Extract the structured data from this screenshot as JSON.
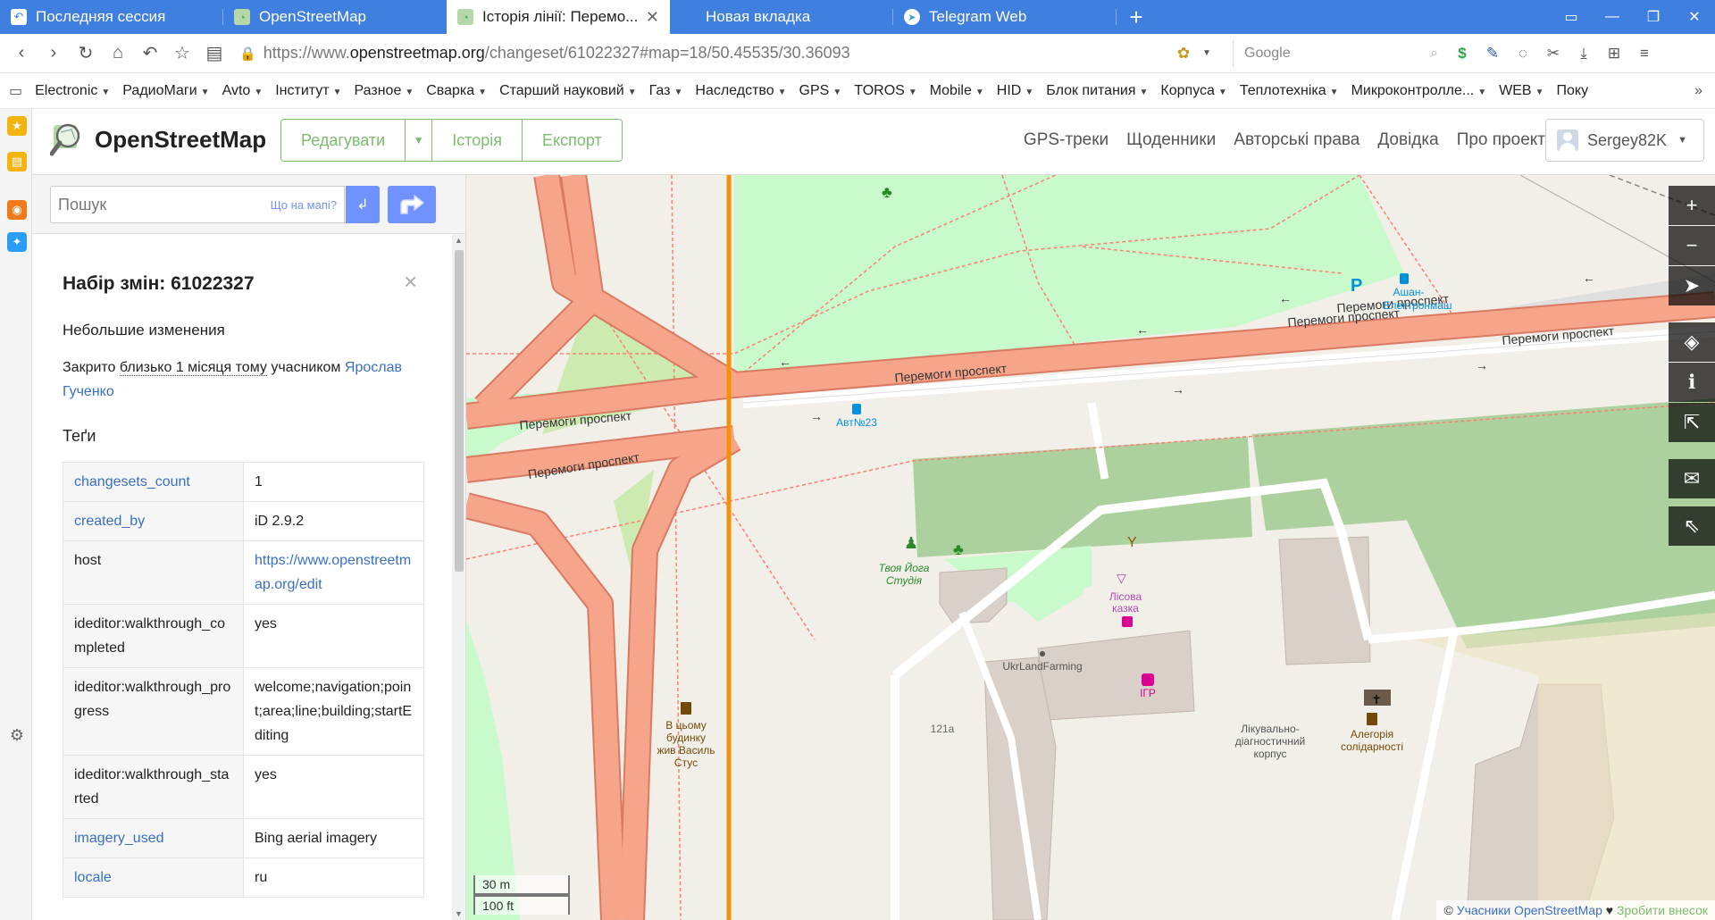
{
  "tabs": [
    {
      "title": "Последняя сессия",
      "icon": "session-icon",
      "active": false
    },
    {
      "title": "OpenStreetMap",
      "icon": "osm-icon",
      "active": false
    },
    {
      "title": "Історія лінії: Перемо...",
      "icon": "osm-icon",
      "active": true
    },
    {
      "title": "Новая вкладка",
      "icon": "",
      "active": false
    },
    {
      "title": "Telegram Web",
      "icon": "telegram-icon",
      "active": false
    }
  ],
  "address": {
    "scheme": "https://www.",
    "host": "openstreetmap.org",
    "path": "/changeset/61022327#map=18/50.45535/30.36093",
    "search_placeholder": "Google"
  },
  "bookmarks": [
    "Electronic",
    "РадиоМаги",
    "Avto",
    "Інститут",
    "Разное",
    "Сварка",
    "Старший науковий",
    "Газ",
    "Наследство",
    "GPS",
    "TOROS",
    "Mobile",
    "HID",
    "Блок питания",
    "Корпуса",
    "Теплотехніка",
    "Микроконтролле...",
    "WEB",
    "Поку"
  ],
  "osm": {
    "logo_text": "OpenStreetMap",
    "edit_label": "Редагувати",
    "history_label": "Історія",
    "export_label": "Експорт",
    "nav": [
      "GPS-треки",
      "Щоденники",
      "Авторські права",
      "Довідка",
      "Про проект"
    ],
    "user": "Sergey82K"
  },
  "search": {
    "placeholder": "Пошук",
    "whats_here": "Що на мапі?"
  },
  "changeset": {
    "title": "Набір змін: 61022327",
    "comment": "Небольшие изменения",
    "closed_prefix": "Закрито",
    "closed_time": "близько 1 місяця тому",
    "closed_by": "учасником",
    "user_first": "Ярослав",
    "user_last": "Гученко",
    "tags_heading": "Теґи",
    "tags": [
      {
        "key": "changesets_count",
        "value": "1",
        "key_link": true,
        "value_link": false
      },
      {
        "key": "created_by",
        "value": "iD 2.9.2",
        "key_link": true,
        "value_link": false
      },
      {
        "key": "host",
        "value": "https://www.openstreetmap.org/edit",
        "key_link": false,
        "value_link": true
      },
      {
        "key": "ideditor:walkthrough_completed",
        "value": "yes",
        "key_link": false,
        "value_link": false
      },
      {
        "key": "ideditor:walkthrough_progress",
        "value": "welcome;navigation;point;area;line;building;startEditing",
        "key_link": false,
        "value_link": false
      },
      {
        "key": "ideditor:walkthrough_started",
        "value": "yes",
        "key_link": false,
        "value_link": false
      },
      {
        "key": "imagery_used",
        "value": "Bing aerial imagery",
        "key_link": true,
        "value_link": false
      },
      {
        "key": "locale",
        "value": "ru",
        "key_link": true,
        "value_link": false
      }
    ]
  },
  "map": {
    "road_labels": [
      "Перемоги проспект",
      "Перемоги проспект",
      "Перемоги проспект",
      "Перемоги проспект",
      "Перемоги проспект",
      "Перемоги проспект"
    ],
    "poi_labels": {
      "ashan": "Ашан-",
      "electronmash": "Електронмаш",
      "bus_stop": "Авт№23",
      "yoga": "Твоя Йога",
      "yoga2": "Студія",
      "forest_tale": "Лісова",
      "forest_tale2": "казка",
      "igr": "ІГР",
      "ukrland": "UkrLandFarming",
      "house_num": "121а",
      "stus1": "В цьому",
      "stus2": "будинку",
      "stus3": "жив Василь",
      "stus4": "Стус",
      "clinic1": "Лікувально-",
      "clinic2": "діагностичний",
      "clinic3": "корпус",
      "allegory1": "Алегорія",
      "allegory2": "солідарності",
      "parking": "P"
    },
    "scale_m": "30 m",
    "scale_ft": "100 ft",
    "attribution_prefix": "©",
    "attribution_link": "Учасники OpenStreetMap",
    "attribution_heart": "♥",
    "attribution_donate": "Зробити внесок",
    "colors": {
      "highlight": "#f39209",
      "trunk": "#f6a58a",
      "trunk_casing": "#d97a63",
      "park": "#c8facc",
      "forest": "#add19e",
      "building": "#d9d0c9"
    }
  }
}
